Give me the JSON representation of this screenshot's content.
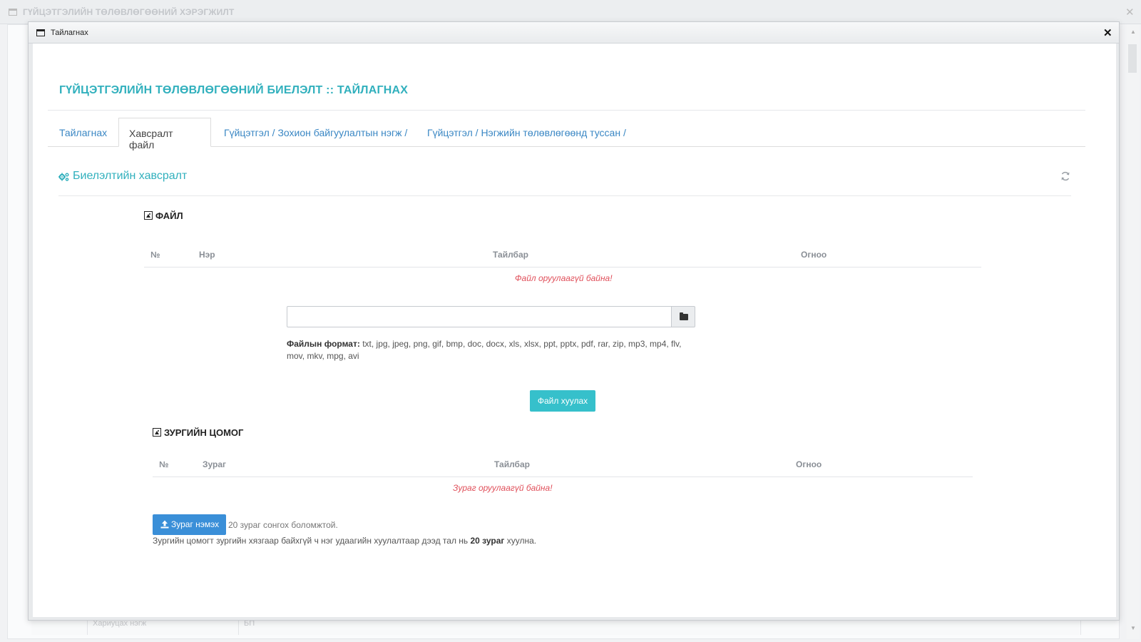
{
  "background": {
    "title": "ГҮЙЦЭТГЭЛИЙН ТӨЛӨВЛӨГӨӨНИЙ ХЭРЭГЖИЛТ",
    "close_label": "✕",
    "row_label": "Хариуцах нэгж",
    "row_value": "БП"
  },
  "modal": {
    "title": "Тайлагнах",
    "close_label": "✕"
  },
  "page": {
    "title": "ГҮЙЦЭТГЭЛИЙН ТӨЛӨВЛӨГӨӨНИЙ БИЕЛЭЛТ :: ТАЙЛАГНАХ"
  },
  "tabs": [
    {
      "label": "Тайлагнах",
      "active": false
    },
    {
      "label": "Хавсралт файл",
      "active": true
    },
    {
      "label": "Гүйцэтгэл / Зохион байгуулалтын нэгж /",
      "active": false
    },
    {
      "label": "Гүйцэтгэл / Нэгжийн төлөвлөгөөнд туссан /",
      "active": false
    }
  ],
  "section": {
    "title": "Биелэлтийн хавсралт"
  },
  "file_section": {
    "title": "ФАЙЛ",
    "columns": [
      "№",
      "Нэр",
      "Тайлбар",
      "Огноо"
    ],
    "empty_message": "Файл оруулаагүй байна!",
    "input_value": "",
    "format_label": "Файлын формат:",
    "format_list": " txt, jpg, jpeg, png, gif, bmp, doc, docx, xls, xlsx, ppt, pptx, pdf, rar, zip, mp3, mp4, flv, mov, mkv, mpg, avi",
    "upload_button": "Файл хуулах"
  },
  "gallery_section": {
    "title": "ЗУРГИЙН ЦОМОГ",
    "columns": [
      "№",
      "Зураг",
      "Тайлбар",
      "Огноо"
    ],
    "empty_message": "Зураг оруулаагүй байна!",
    "add_button": "Зураг нэмэх",
    "add_hint": "20 зураг сонгох боломжтой.",
    "note_prefix": "Зургийн цомогт зургийн хязгаар байхгүй ч нэг удаагийн хуулалтаар дээд тал нь ",
    "note_bold": "20 зураг",
    "note_suffix": " хуулна."
  },
  "colors": {
    "accent_teal": "#31b0bd",
    "link_blue": "#3a87c4",
    "error_red": "#e0505b",
    "button_teal": "#36c0cb",
    "button_blue": "#3a8fd8"
  }
}
